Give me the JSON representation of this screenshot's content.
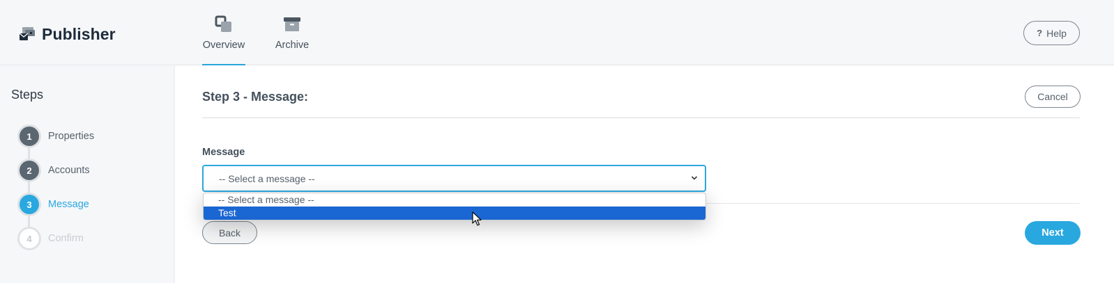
{
  "app": {
    "title": "Publisher"
  },
  "nav": [
    {
      "label": "Overview",
      "active": true,
      "icon": "overview-icon"
    },
    {
      "label": "Archive",
      "active": false,
      "icon": "archive-icon"
    }
  ],
  "help": {
    "label": "Help",
    "icon": "question-icon"
  },
  "steps": {
    "title": "Steps",
    "items": [
      {
        "number": "1",
        "label": "Properties",
        "state": "done"
      },
      {
        "number": "2",
        "label": "Accounts",
        "state": "done"
      },
      {
        "number": "3",
        "label": "Message",
        "state": "active"
      },
      {
        "number": "4",
        "label": "Confirm",
        "state": "todo"
      }
    ]
  },
  "main": {
    "title": "Step 3 - Message:",
    "cancel_label": "Cancel",
    "field_label": "Message",
    "select": {
      "value": "-- Select a message --",
      "options": [
        "-- Select a message --",
        "Test"
      ],
      "highlighted": "Test"
    },
    "back_label": "Back",
    "next_label": "Next"
  },
  "colors": {
    "accent": "#29a8e0",
    "selection": "#1a66d2",
    "step_done": "#5a6670"
  }
}
